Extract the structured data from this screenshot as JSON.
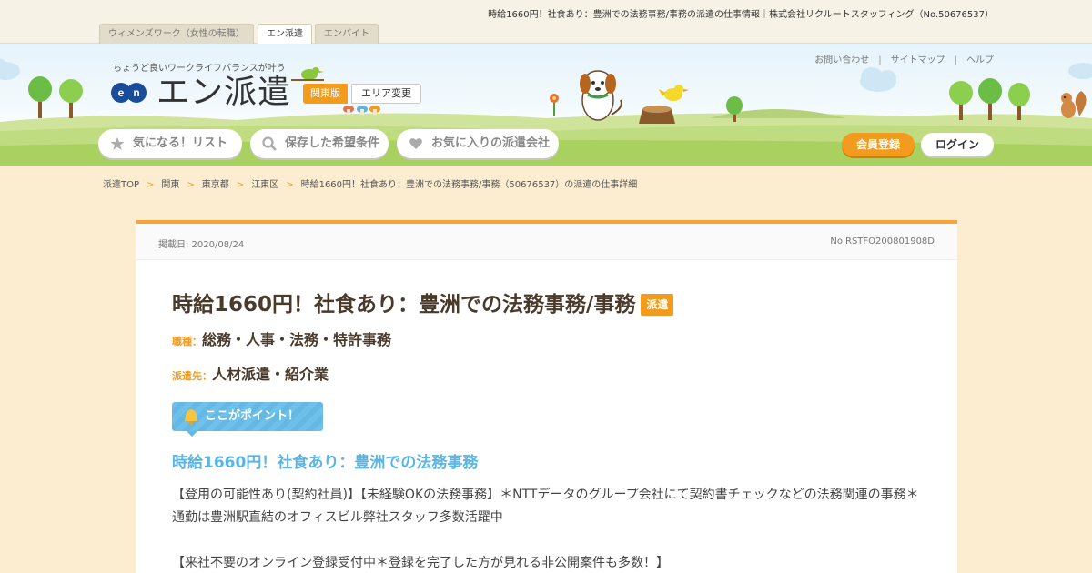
{
  "page_info": "時給1660円！社食あり：豊洲での法務事務/事務の派遣の仕事情報｜株式会社リクルートスタッフィング（No.50676537）",
  "site_tabs": [
    {
      "label": "ウィメンズワーク（女性の転職）"
    },
    {
      "label": "エン派遣"
    },
    {
      "label": "エンバイト"
    }
  ],
  "header": {
    "tagline": "ちょうど良いワークライフバランスが叶う",
    "logo_en": "en",
    "logo_text": "エン派遣",
    "region": "関東版",
    "area_change": "エリア変更",
    "util_links": [
      "お問い合わせ",
      "サイトマップ",
      "ヘルプ"
    ],
    "nav": [
      {
        "label": "気になる！リスト",
        "icon": "star-icon"
      },
      {
        "label": "保存した希望条件",
        "icon": "search-icon"
      },
      {
        "label": "お気に入りの派遣会社",
        "icon": "heart-icon"
      }
    ],
    "register": "会員登録",
    "login": "ログイン"
  },
  "breadcrumb": [
    "派遣TOP",
    "関東",
    "東京都",
    "江東区",
    "時給1660円！社食あり：豊洲での法務事務/事務（50676537）の派遣の仕事詳細"
  ],
  "job": {
    "posted": "掲載日: 2020/08/24",
    "number": "No.RSTFO200801908D",
    "title": "時給1660円！社食あり：豊洲での法務事務/事務",
    "badge": "派遣",
    "occupation_label": "職種：",
    "occupation": "総務・人事・法務・特許事務",
    "dispatch_label": "派遣先：",
    "dispatch": "人材派遣・紹介業",
    "point_label": "ここがポイント！",
    "catch": "時給1660円！社食あり：豊洲での法務事務",
    "description": "【登用の可能性あり(契約社員)】【未経験OKの法務事務】＊NTTデータのグループ会社にて契約書チェックなどの法務関連の事務＊通勤は豊洲駅直結のオフィスビル弊社スタッフ多数活躍中",
    "description2": "【来社不要のオンライン登録受付中＊登録を完了した方が見れる非公開案件も多数！】"
  },
  "colors": {
    "accent": "#f39b1c",
    "point_blue": "#5bb5e3",
    "title_brown": "#4a3a2a",
    "page_bg": "#fcecd0"
  }
}
